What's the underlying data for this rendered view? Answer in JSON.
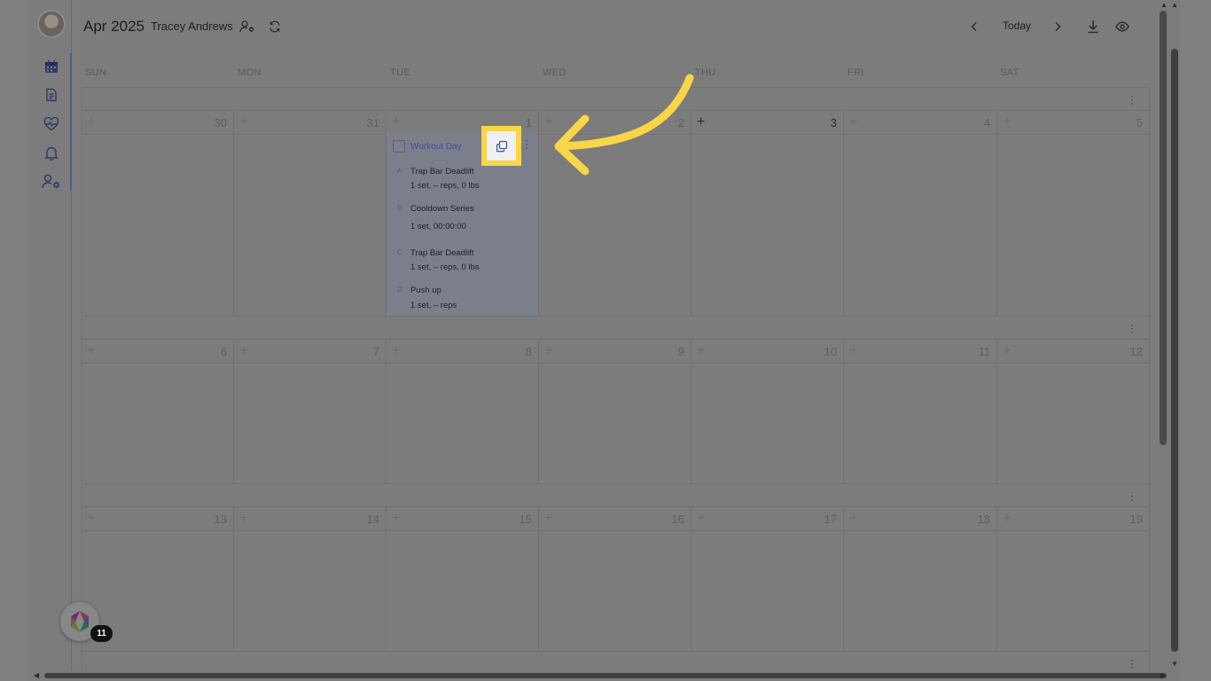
{
  "header": {
    "month_title": "Apr 2025",
    "client_name": "Tracey Andrews",
    "today_label": "Today"
  },
  "sidebar": {
    "items": [
      {
        "name": "calendar"
      },
      {
        "name": "document"
      },
      {
        "name": "health"
      },
      {
        "name": "notifications"
      },
      {
        "name": "client-settings"
      }
    ]
  },
  "calendar": {
    "weekdays": [
      "SUN",
      "MON",
      "TUE",
      "WED",
      "THU",
      "FRI",
      "SAT"
    ],
    "weeks": [
      {
        "days": [
          "30",
          "31",
          "1",
          "2",
          "3",
          "4",
          "5"
        ]
      },
      {
        "days": [
          "6",
          "7",
          "8",
          "9",
          "10",
          "11",
          "12"
        ]
      },
      {
        "days": [
          "13",
          "14",
          "15",
          "16",
          "17",
          "18",
          "19"
        ]
      }
    ],
    "current_day": "3"
  },
  "workout": {
    "title": "Workout Day",
    "exercises": [
      {
        "letter": "A",
        "name": "Trap Bar Deadlift",
        "detail": "1 set, – reps, 0 lbs"
      },
      {
        "letter": "B",
        "name": "Cooldown Series",
        "detail": "1 set, 00:00:00"
      },
      {
        "letter": "C",
        "name": "Trap Bar Deadlift",
        "detail": "1 set, – reps, 0 lbs"
      },
      {
        "letter": "D",
        "name": "Push up",
        "detail": "1 set, – reps"
      }
    ]
  },
  "widget": {
    "badge_count": "11"
  },
  "colors": {
    "highlight": "#f9d548",
    "arrow": "#f9d548",
    "overlay_gray": "#7c7c7c",
    "workout_title": "#40508f"
  }
}
